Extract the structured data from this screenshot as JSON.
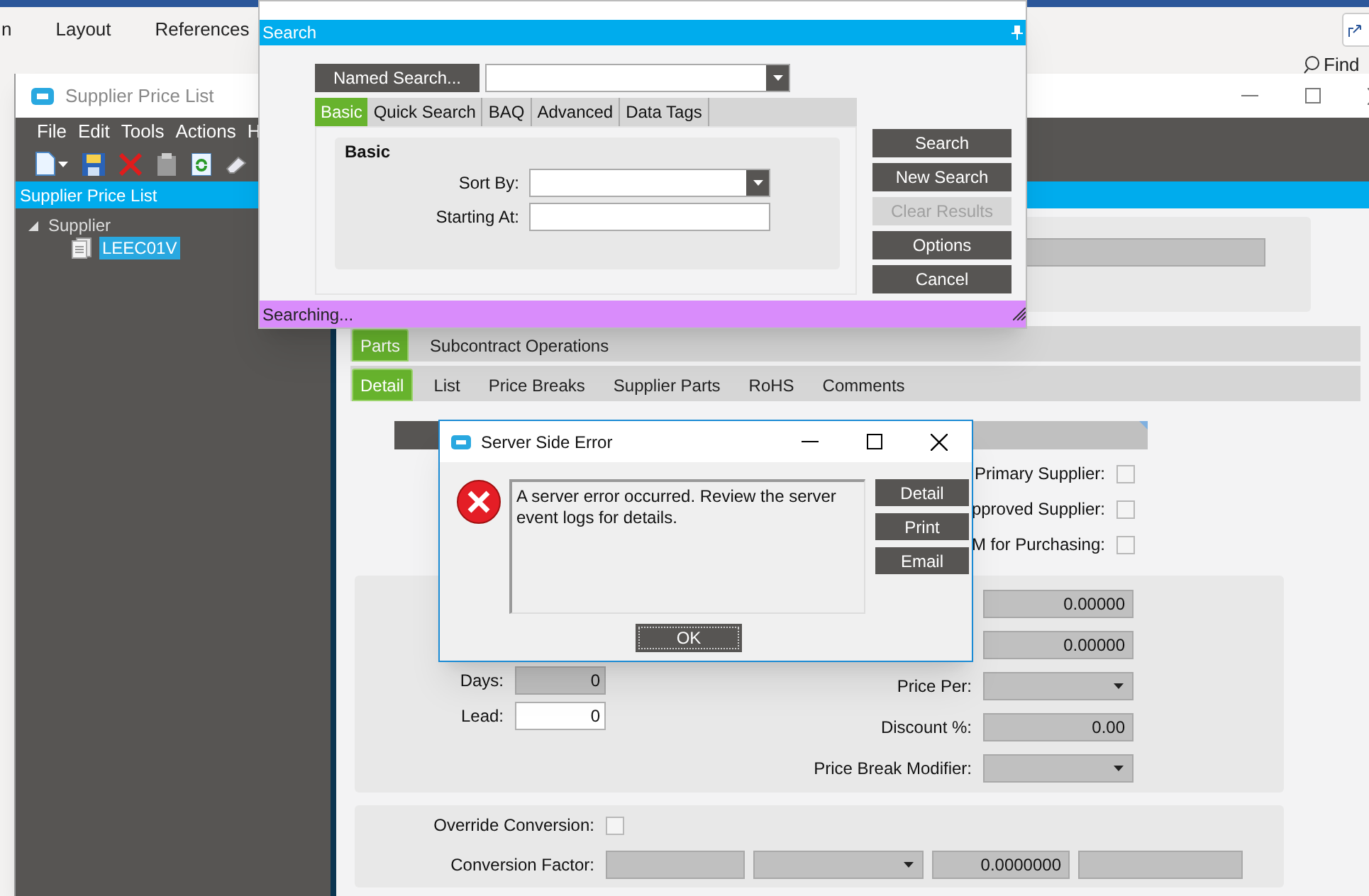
{
  "word_ribbon": {
    "tabs": [
      {
        "label": "n"
      },
      {
        "label": "Layout"
      },
      {
        "label": "References"
      }
    ],
    "find": "Find"
  },
  "supplier_window": {
    "title": "Supplier Price List",
    "menu": [
      "File",
      "Edit",
      "Tools",
      "Actions",
      "H"
    ],
    "panel_title": "Supplier Price List",
    "tree": [
      {
        "label": "Supplier",
        "expanded": true,
        "selected": false,
        "children": [
          {
            "label": "LEEC01V",
            "selected": true
          }
        ]
      }
    ],
    "top_tabs": [
      {
        "label": "Parts",
        "selected": true
      },
      {
        "label": "Subcontract Operations",
        "selected": false
      }
    ],
    "detail_tabs": [
      {
        "label": "Detail",
        "selected": true
      },
      {
        "label": "List",
        "selected": false
      },
      {
        "label": "Price Breaks",
        "selected": false
      },
      {
        "label": "Supplier Parts",
        "selected": false
      },
      {
        "label": "RoHS",
        "selected": false
      },
      {
        "label": "Comments",
        "selected": false
      }
    ],
    "flags": [
      {
        "label": "Primary Supplier:",
        "checked": false
      },
      {
        "label": "pproved Supplier:",
        "checked": false
      },
      {
        "label": "M for Purchasing:",
        "checked": false
      }
    ],
    "lead_fields": [
      {
        "label": "Days:",
        "value": "0",
        "disabled": true
      },
      {
        "label": "Lead:",
        "value": "0",
        "disabled": false
      }
    ],
    "price_fields": [
      {
        "kind": "number",
        "value": "0.00000"
      },
      {
        "kind": "number",
        "value": "0.00000"
      },
      {
        "kind": "dropdown",
        "label": "Price Per:"
      },
      {
        "kind": "number",
        "label": "Discount %:",
        "value": "0.00"
      },
      {
        "kind": "dropdown",
        "label": "Price Break Modifier:"
      }
    ],
    "conversion": {
      "override_label": "Override Conversion:",
      "override_checked": false,
      "factor_label": "Conversion Factor:",
      "factor_fields": [
        {
          "kind": "text"
        },
        {
          "kind": "dropdown"
        },
        {
          "kind": "number",
          "value": "0.0000000"
        },
        {
          "kind": "text"
        }
      ]
    }
  },
  "search_window": {
    "header": "Search",
    "named_search": "Named Search...",
    "tabs": [
      {
        "label": "Basic",
        "selected": true
      },
      {
        "label": "Quick Search",
        "selected": false
      },
      {
        "label": "BAQ",
        "selected": false
      },
      {
        "label": "Advanced",
        "selected": false
      },
      {
        "label": "Data Tags",
        "selected": false
      }
    ],
    "group_title": "Basic",
    "fields": [
      {
        "kind": "dropdown",
        "label": "Sort By:"
      },
      {
        "kind": "text",
        "label": "Starting At:"
      }
    ],
    "buttons": [
      {
        "label": "Search",
        "disabled": false
      },
      {
        "label": "New Search",
        "disabled": false
      },
      {
        "label": "Clear Results",
        "disabled": true
      },
      {
        "label": "Options",
        "disabled": false
      },
      {
        "label": "Cancel",
        "disabled": false
      }
    ],
    "status": "Searching..."
  },
  "error_dialog": {
    "title": "Server Side Error",
    "message": "A server error occurred. Review the server event logs for details.",
    "buttons": [
      {
        "label": "Detail"
      },
      {
        "label": "Print"
      },
      {
        "label": "Email"
      }
    ],
    "ok": "OK"
  }
}
